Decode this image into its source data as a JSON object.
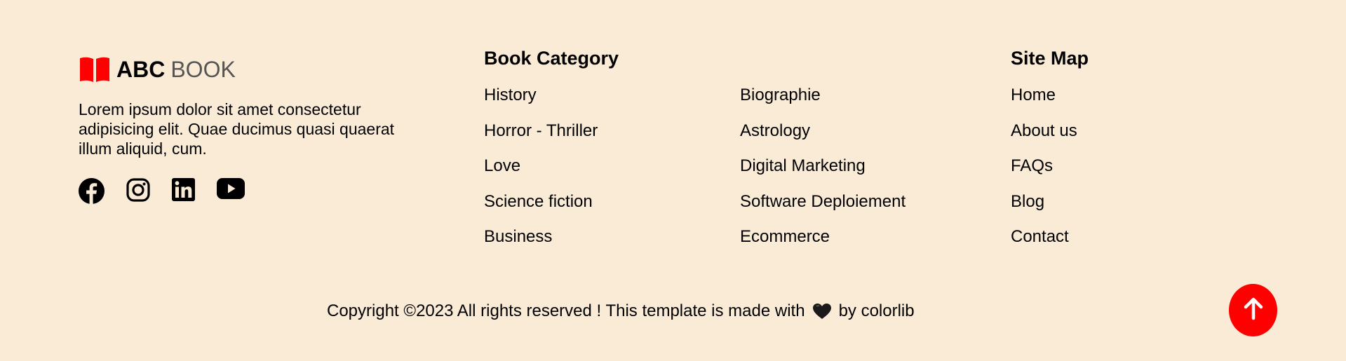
{
  "brand": {
    "name_bold": "ABC",
    "name_light": "BOOK",
    "icon": "open-book-icon",
    "icon_color": "#ff0000"
  },
  "about": {
    "text": "Lorem ipsum dolor sit amet consectetur adipisicing elit. Quae ducimus quasi quaerat illum aliquid, cum."
  },
  "socials": [
    {
      "name": "facebook-icon"
    },
    {
      "name": "instagram-icon"
    },
    {
      "name": "linkedin-icon"
    },
    {
      "name": "youtube-icon"
    }
  ],
  "book_category": {
    "title": "Book Category",
    "col1": [
      "History",
      "Horror - Thriller",
      "Love",
      "Science fiction",
      "Business"
    ],
    "col2": [
      "Biographie",
      "Astrology",
      "Digital Marketing",
      "Software Deploiement",
      "Ecommerce"
    ]
  },
  "site_map": {
    "title": "Site Map",
    "items": [
      "Home",
      "About us",
      "FAQs",
      "Blog",
      "Contact"
    ]
  },
  "copyright": {
    "prefix": "Copyright ©2023 All rights reserved ! This template is made with",
    "icon": "heart-icon",
    "suffix": "by colorlib"
  },
  "to_top": {
    "icon": "arrow-up-icon",
    "color": "#ff0000"
  },
  "colors": {
    "background": "#faebd7",
    "accent": "#ff0000",
    "text": "#000000"
  }
}
